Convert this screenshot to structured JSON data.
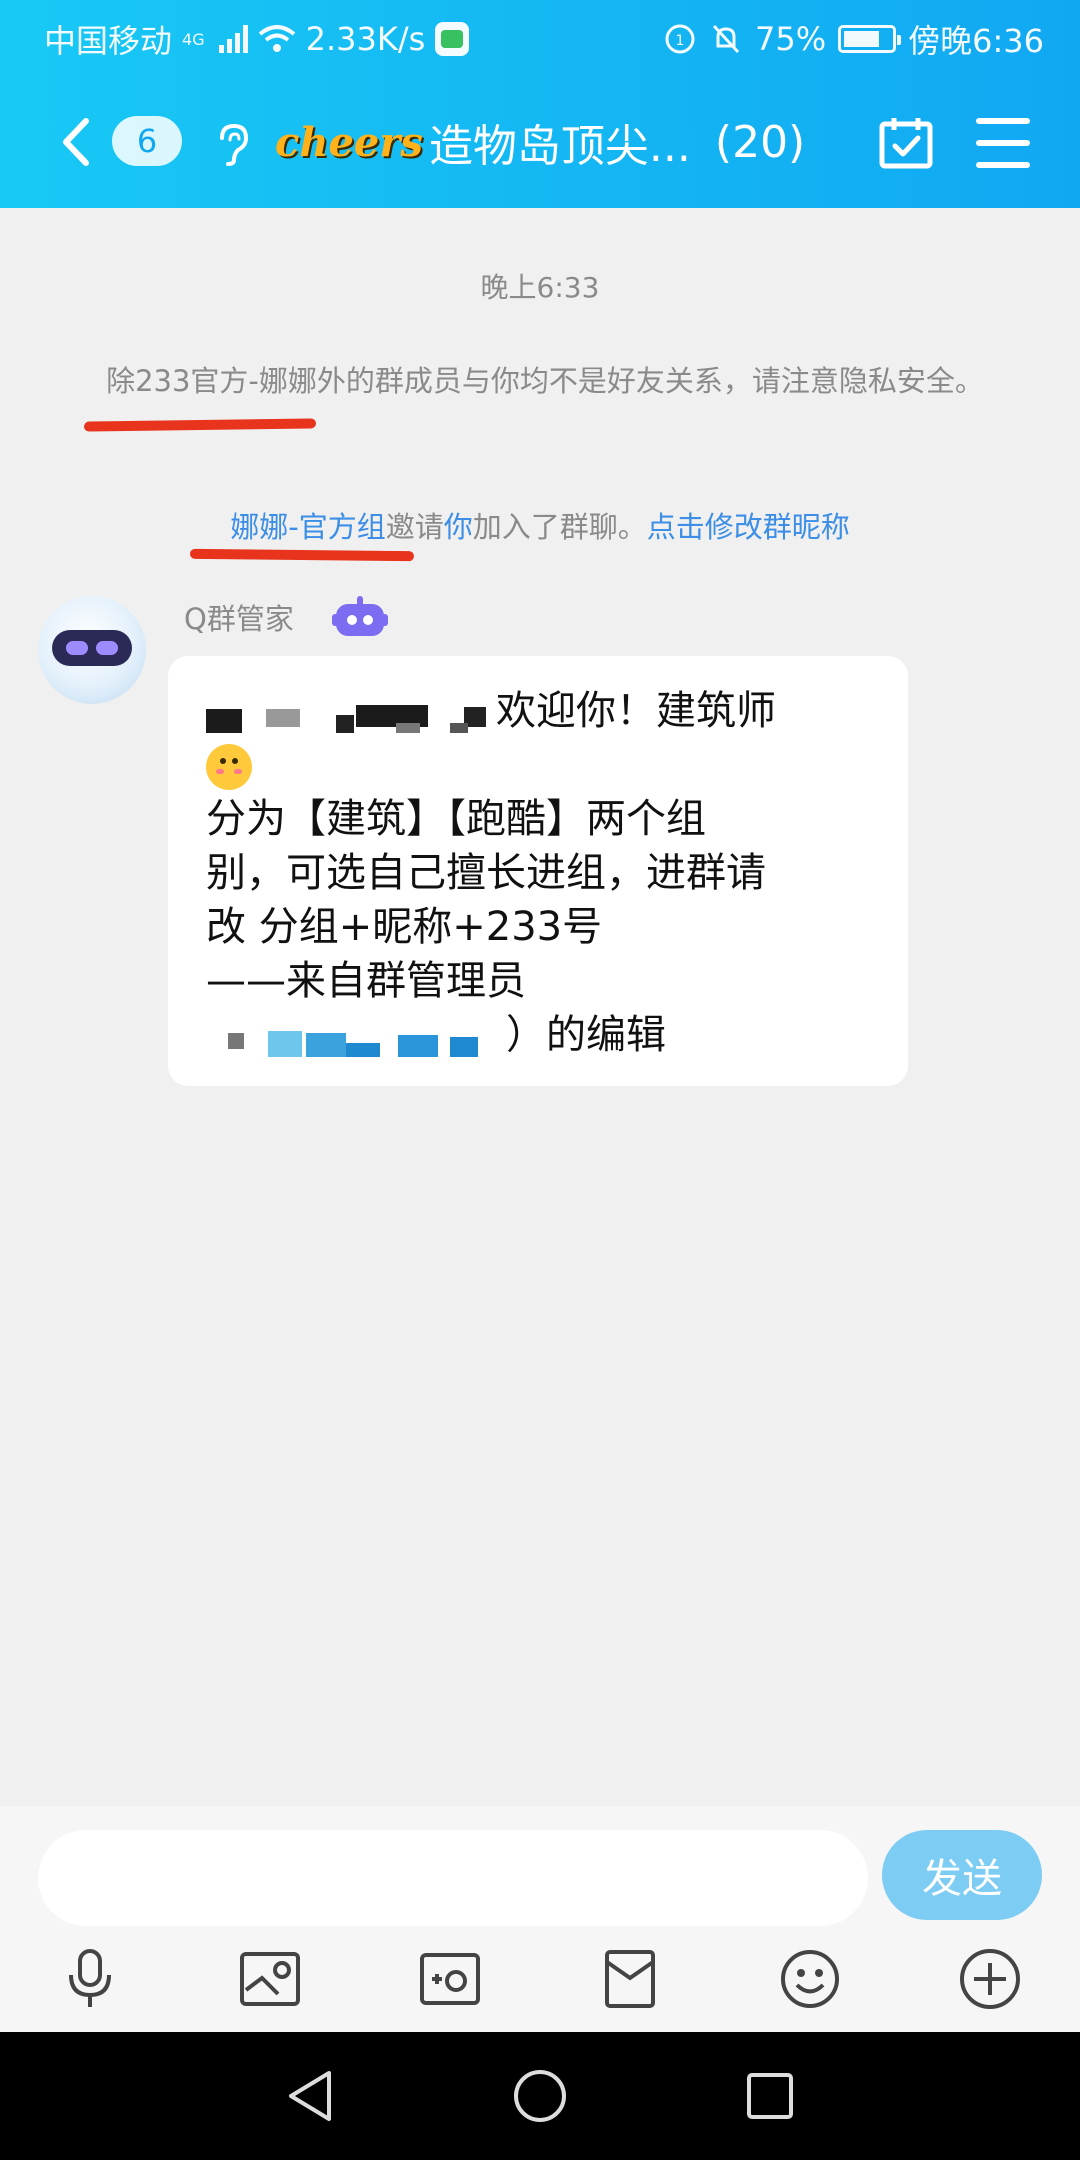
{
  "status_bar": {
    "carrier": "中国移动",
    "network_type": "4G",
    "speed": "2.33K/s",
    "battery": "75%",
    "battery_level": 0.75,
    "time": "傍晚6:36"
  },
  "header": {
    "unread_count": "6",
    "logo_text": "cheers",
    "group_name": "造物岛顶尖...",
    "member_count": "(20)"
  },
  "chat": {
    "timestamp": "晚上6:33",
    "privacy_notice": "除233官方-娜娜外的群成员与你均不是好友关系，请注意隐私安全。",
    "invite": {
      "inviter": "娜娜-官方组",
      "text1": "邀请",
      "you": "你",
      "text2": "加入了群聊。",
      "action": "点击修改群昵称"
    },
    "message": {
      "sender": "Q群管家",
      "line1_suffix": "欢迎你！建筑师",
      "line2": "分为【建筑】【跑酷】两个组",
      "line3": "别，可选自己擅长进组，进群请",
      "line4": "改 分组+昵称+233号",
      "line5": "——来自群管理员",
      "line6_suffix": "）的编辑"
    }
  },
  "composer": {
    "placeholder": "",
    "send_label": "发送"
  },
  "colors": {
    "header_gradient_start": "#18c9f5",
    "header_gradient_end": "#11a8f2",
    "link": "#3c8ee6",
    "annotation_red": "#e8341c",
    "send_button": "#7cccf3"
  },
  "icons": {
    "toolbar": [
      "microphone-icon",
      "photo-icon",
      "camera-icon",
      "red-packet-icon",
      "emoji-icon",
      "plus-icon"
    ],
    "nav": [
      "back-triangle-icon",
      "home-circle-icon",
      "recents-square-icon"
    ]
  }
}
